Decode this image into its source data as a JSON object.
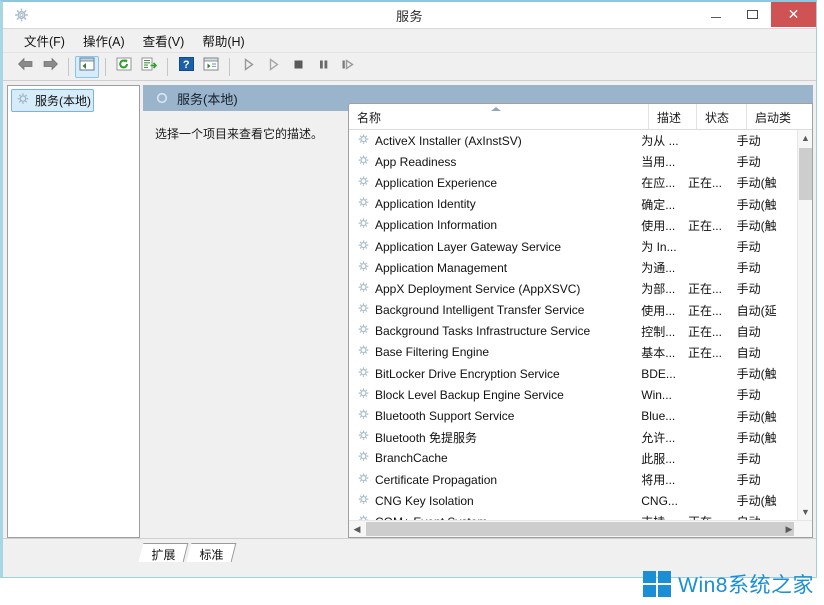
{
  "window": {
    "title": "服务",
    "icon": "services-gear-icon",
    "minimize_label": "最小化",
    "maximize_label": "最大化",
    "close_label": "关闭"
  },
  "menubar": {
    "items": [
      {
        "label": "文件(F)",
        "name": "menu-file"
      },
      {
        "label": "操作(A)",
        "name": "menu-action"
      },
      {
        "label": "查看(V)",
        "name": "menu-view"
      },
      {
        "label": "帮助(H)",
        "name": "menu-help"
      }
    ]
  },
  "toolbar": {
    "buttons": [
      {
        "name": "back-button",
        "icon": "back-arrow-icon",
        "active": false
      },
      {
        "name": "forward-button",
        "icon": "forward-arrow-icon",
        "active": false
      },
      {
        "name": "show-hide-console-tree-button",
        "icon": "tree-pane-icon",
        "active": true
      },
      {
        "name": "refresh-button",
        "icon": "refresh-icon",
        "active": false
      },
      {
        "name": "export-list-button",
        "icon": "export-list-icon",
        "active": false
      },
      {
        "name": "help-button",
        "icon": "help-question-icon",
        "active": false
      },
      {
        "name": "properties-button",
        "icon": "properties-icon",
        "active": false
      },
      {
        "name": "start-service-button",
        "icon": "play-icon",
        "active": false
      },
      {
        "name": "resume-service-button",
        "icon": "resume-icon",
        "active": false
      },
      {
        "name": "stop-service-button",
        "icon": "stop-square-icon",
        "active": false
      },
      {
        "name": "pause-service-button",
        "icon": "pause-icon",
        "active": false
      },
      {
        "name": "restart-service-button",
        "icon": "restart-icon",
        "active": false
      }
    ]
  },
  "tree": {
    "root_label": "服务(本地)",
    "root_icon": "services-gear-icon"
  },
  "detail": {
    "header_title": "服务(本地)",
    "header_icon": "services-circle-icon",
    "description": "选择一个项目来查看它的描述。"
  },
  "list": {
    "columns": [
      {
        "label": "名称",
        "name": "column-name"
      },
      {
        "label": "描述",
        "name": "column-description"
      },
      {
        "label": "状态",
        "name": "column-status"
      },
      {
        "label": "启动类",
        "name": "column-startup-type"
      }
    ],
    "sort_column": "名称",
    "sort_direction": "ascending",
    "rows": [
      {
        "name": "ActiveX Installer (AxInstSV)",
        "desc": "为从 ...",
        "state": "",
        "startup": "手动"
      },
      {
        "name": "App Readiness",
        "desc": "当用...",
        "state": "",
        "startup": "手动"
      },
      {
        "name": "Application Experience",
        "desc": "在应...",
        "state": "正在...",
        "startup": "手动(触"
      },
      {
        "name": "Application Identity",
        "desc": "确定...",
        "state": "",
        "startup": "手动(触"
      },
      {
        "name": "Application Information",
        "desc": "使用...",
        "state": "正在...",
        "startup": "手动(触"
      },
      {
        "name": "Application Layer Gateway Service",
        "desc": "为 In...",
        "state": "",
        "startup": "手动"
      },
      {
        "name": "Application Management",
        "desc": "为通...",
        "state": "",
        "startup": "手动"
      },
      {
        "name": "AppX Deployment Service (AppXSVC)",
        "desc": "为部...",
        "state": "正在...",
        "startup": "手动"
      },
      {
        "name": "Background Intelligent Transfer Service",
        "desc": "使用...",
        "state": "正在...",
        "startup": "自动(延"
      },
      {
        "name": "Background Tasks Infrastructure Service",
        "desc": "控制...",
        "state": "正在...",
        "startup": "自动"
      },
      {
        "name": "Base Filtering Engine",
        "desc": "基本...",
        "state": "正在...",
        "startup": "自动"
      },
      {
        "name": "BitLocker Drive Encryption Service",
        "desc": "BDE...",
        "state": "",
        "startup": "手动(触"
      },
      {
        "name": "Block Level Backup Engine Service",
        "desc": "Win...",
        "state": "",
        "startup": "手动"
      },
      {
        "name": "Bluetooth Support Service",
        "desc": "Blue...",
        "state": "",
        "startup": "手动(触"
      },
      {
        "name": "Bluetooth 免提服务",
        "desc": "允许...",
        "state": "",
        "startup": "手动(触"
      },
      {
        "name": "BranchCache",
        "desc": "此服...",
        "state": "",
        "startup": "手动"
      },
      {
        "name": "Certificate Propagation",
        "desc": "将用...",
        "state": "",
        "startup": "手动"
      },
      {
        "name": "CNG Key Isolation",
        "desc": "CNG...",
        "state": "",
        "startup": "手动(触"
      },
      {
        "name": "COM+ Event System",
        "desc": "支持...",
        "state": "正在...",
        "startup": "自动"
      }
    ]
  },
  "tabs": [
    {
      "label": "扩展",
      "name": "tab-extended"
    },
    {
      "label": "标准",
      "name": "tab-standard"
    }
  ],
  "watermark": {
    "text": "Win8系统之家",
    "logo": "windows-logo-icon",
    "color": "#1a8fd6"
  },
  "colors": {
    "window_border": "#9fd0e0",
    "detail_header": "#9ab4cc",
    "selection": "#d6ecfb",
    "selection_border": "#7ab4dd",
    "close_button": "#cf5353",
    "chrome": "#f0f0f0"
  }
}
